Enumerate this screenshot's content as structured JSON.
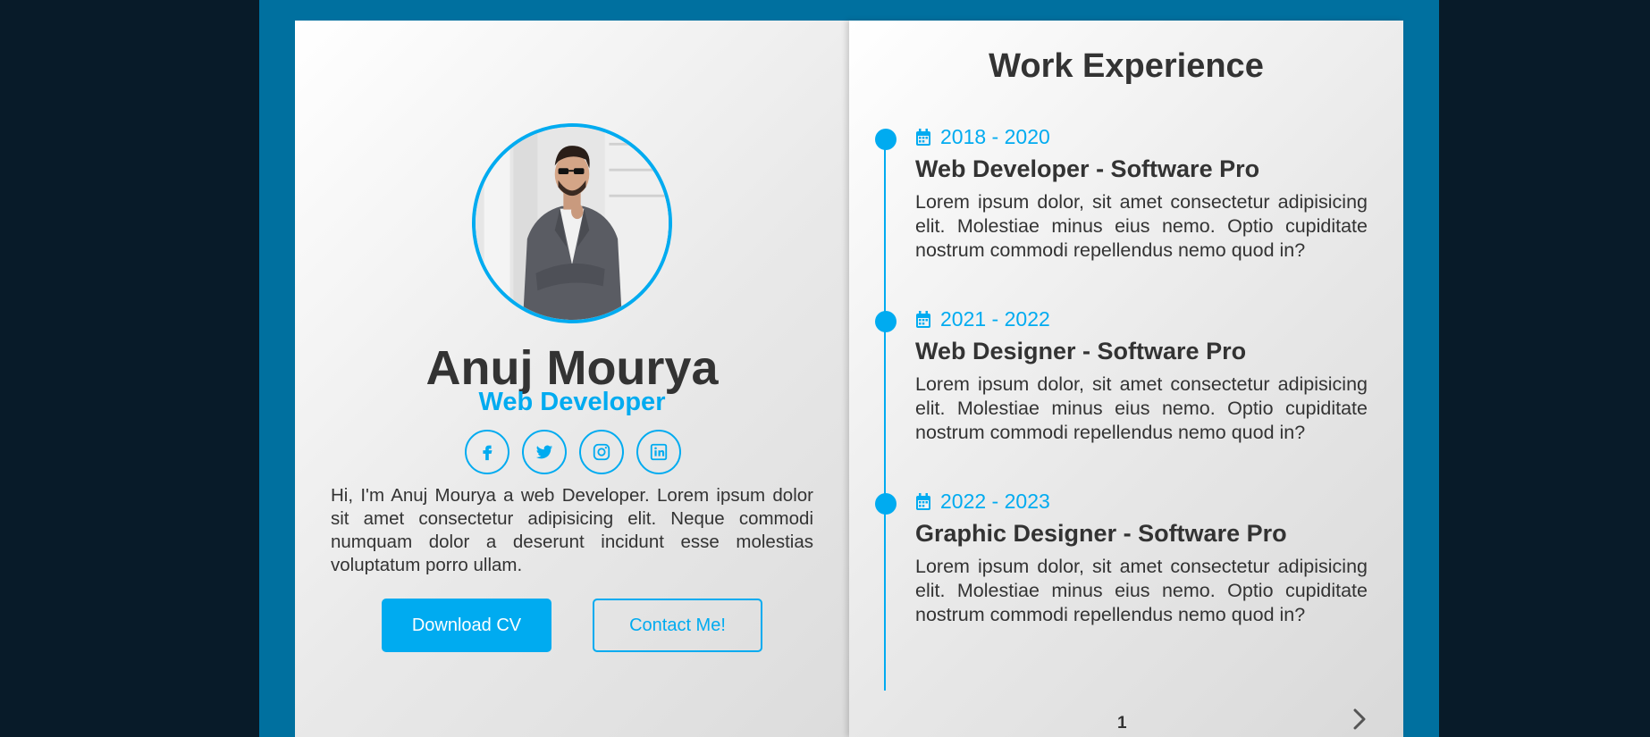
{
  "profile": {
    "name": "Anuj Mourya",
    "role": "Web Developer",
    "bio": "Hi, I'm Anuj Mourya a web Developer. Lorem ipsum dolor sit amet consectetur adipisicing elit. Neque commodi numquam dolor a deserunt incidunt esse molestias voluptatum porro ullam.",
    "socials": [
      {
        "icon": "facebook-icon"
      },
      {
        "icon": "twitter-icon"
      },
      {
        "icon": "instagram-icon"
      },
      {
        "icon": "linkedin-icon"
      }
    ],
    "buttons": {
      "download_label": "Download CV",
      "contact_label": "Contact Me!"
    }
  },
  "experience": {
    "title": "Work Experience",
    "items": [
      {
        "date": "2018 - 2020",
        "title": "Web Developer - Software Pro",
        "text": "Lorem ipsum dolor, sit amet consectetur adipisicing elit. Molestiae minus eius nemo. Optio cupiditate nostrum commodi repellendus nemo quod in?"
      },
      {
        "date": "2021 - 2022",
        "title": "Web Designer - Software Pro",
        "text": "Lorem ipsum dolor, sit amet consectetur adipisicing elit. Molestiae minus eius nemo. Optio cupiditate nostrum commodi repellendus nemo quod in?"
      },
      {
        "date": "2022 - 2023",
        "title": "Graphic Designer - Software Pro",
        "text": "Lorem ipsum dolor, sit amet consectetur adipisicing elit. Molestiae minus eius nemo. Optio cupiditate nostrum commodi repellendus nemo quod in?"
      }
    ],
    "page_number": "1"
  },
  "colors": {
    "accent": "#00abf0",
    "background": "#081b29",
    "book_cover": "#00709f",
    "text": "#333333"
  }
}
